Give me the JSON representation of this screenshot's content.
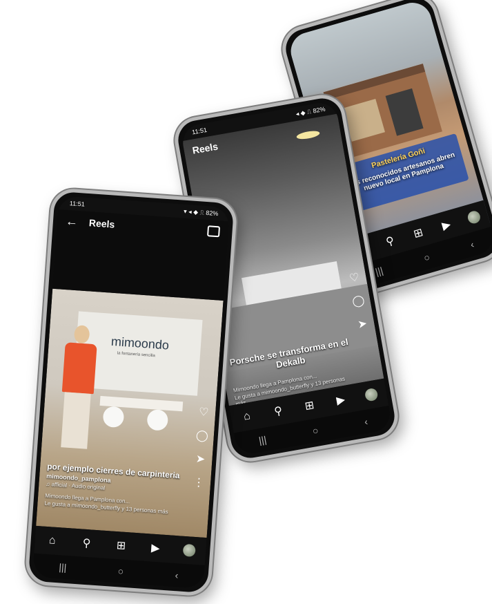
{
  "phone_front": {
    "status_time": "11:51",
    "status_right": "▾ ◂ ◆ ⎍ 82%",
    "title": "Reels",
    "brand": "mimoondo",
    "brand_sub": "la fontanería sencilla",
    "caption_big": "por ejemplo cierres de carpinteria",
    "account": "mimoondo_pamplona",
    "audio": "♫ afficial · Audio original",
    "sub1": "Mimoondo llega a Pamplona con...",
    "sub2": "Le gusta a mimoondo_butterfly y 13 personas más"
  },
  "phone_middle": {
    "status_time": "11:51",
    "status_right": "◂ ◆ ⎍ 82%",
    "title": "Reels",
    "caption_big": "Porsche se transforma en el Dekalb",
    "sub1": "Mimoondo llega a Pamplona con...",
    "sub2": "Le gusta a mimoondo_butterfly y 13 personas más"
  },
  "phone_back": {
    "sign_title": "Pastelería Goñi",
    "sign_text": "Los reconocidos artesanos abren nuevo local en Pamplona"
  },
  "nav": {
    "home": "⌂",
    "search": "⚲",
    "add": "⊞",
    "reels": "▶"
  },
  "sys": {
    "recent": "|||",
    "home": "○",
    "back": "‹"
  },
  "icons": {
    "like": "♡",
    "comment": "◯",
    "share": "➤",
    "more": "⋮"
  }
}
